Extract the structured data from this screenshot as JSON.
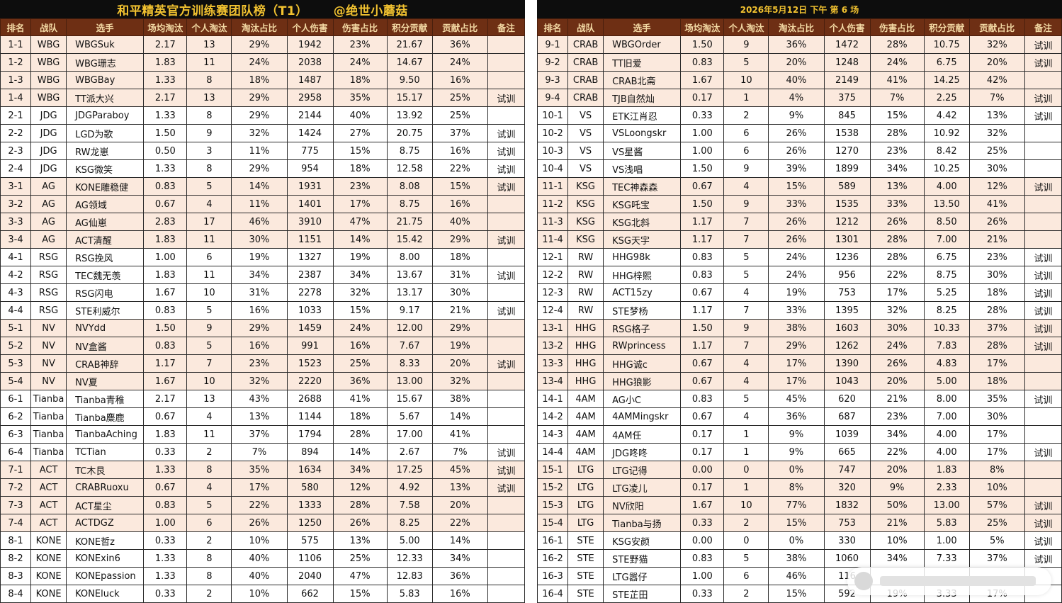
{
  "left": {
    "title": "和平精英官方训练赛团队榜（T1）",
    "author": "@绝世小蘑菇",
    "headers": [
      "排名",
      "战队",
      "选手",
      "场均淘汰",
      "个人淘汰",
      "淘汰占比",
      "个人伤害",
      "伤害占比",
      "积分贡献",
      "贡献占比",
      "备注"
    ],
    "rows": [
      [
        "1-1",
        "WBG",
        "WBGSuk",
        "2.17",
        "13",
        "29%",
        "1942",
        "23%",
        "21.67",
        "36%",
        ""
      ],
      [
        "1-2",
        "WBG",
        "WBG珊志",
        "1.83",
        "11",
        "24%",
        "2038",
        "24%",
        "14.67",
        "24%",
        ""
      ],
      [
        "1-3",
        "WBG",
        "WBGBay",
        "1.33",
        "8",
        "18%",
        "1487",
        "18%",
        "9.50",
        "16%",
        ""
      ],
      [
        "1-4",
        "WBG",
        "TT派大兴",
        "2.17",
        "13",
        "29%",
        "2958",
        "35%",
        "15.17",
        "25%",
        "试训"
      ],
      [
        "2-1",
        "JDG",
        "JDGParaboy",
        "1.33",
        "8",
        "29%",
        "2144",
        "40%",
        "13.92",
        "25%",
        ""
      ],
      [
        "2-2",
        "JDG",
        "LGD为歌",
        "1.50",
        "9",
        "32%",
        "1424",
        "27%",
        "20.75",
        "37%",
        "试训"
      ],
      [
        "2-3",
        "JDG",
        "RW龙崽",
        "0.50",
        "3",
        "11%",
        "775",
        "15%",
        "8.75",
        "16%",
        "试训"
      ],
      [
        "2-4",
        "JDG",
        "KSG微笑",
        "1.33",
        "8",
        "29%",
        "954",
        "18%",
        "12.58",
        "22%",
        "试训"
      ],
      [
        "3-1",
        "AG",
        "KONE雕稳健",
        "0.83",
        "5",
        "14%",
        "1931",
        "23%",
        "8.08",
        "15%",
        "试训"
      ],
      [
        "3-2",
        "AG",
        "AG领域",
        "0.67",
        "4",
        "11%",
        "1401",
        "17%",
        "8.75",
        "16%",
        ""
      ],
      [
        "3-3",
        "AG",
        "AG仙崽",
        "2.83",
        "17",
        "46%",
        "3910",
        "47%",
        "21.75",
        "40%",
        ""
      ],
      [
        "3-4",
        "AG",
        "ACT清醒",
        "1.83",
        "11",
        "30%",
        "1151",
        "14%",
        "15.42",
        "29%",
        "试训"
      ],
      [
        "4-1",
        "RSG",
        "RSG挽风",
        "1.00",
        "6",
        "19%",
        "1327",
        "19%",
        "8.00",
        "18%",
        ""
      ],
      [
        "4-2",
        "RSG",
        "TEC魏无羡",
        "1.83",
        "11",
        "34%",
        "2387",
        "34%",
        "13.67",
        "31%",
        "试训"
      ],
      [
        "4-3",
        "RSG",
        "RSG闪电",
        "1.67",
        "10",
        "31%",
        "2278",
        "32%",
        "13.17",
        "30%",
        ""
      ],
      [
        "4-4",
        "RSG",
        "STE利威尔",
        "0.83",
        "5",
        "16%",
        "1033",
        "15%",
        "9.17",
        "21%",
        "试训"
      ],
      [
        "5-1",
        "NV",
        "NVYdd",
        "1.50",
        "9",
        "29%",
        "1459",
        "24%",
        "12.00",
        "29%",
        ""
      ],
      [
        "5-2",
        "NV",
        "NV盒酱",
        "0.83",
        "5",
        "16%",
        "991",
        "16%",
        "7.67",
        "19%",
        ""
      ],
      [
        "5-3",
        "NV",
        "CRAB神辞",
        "1.17",
        "7",
        "23%",
        "1523",
        "25%",
        "8.33",
        "20%",
        "试训"
      ],
      [
        "5-4",
        "NV",
        "NV夏",
        "1.67",
        "10",
        "32%",
        "2220",
        "36%",
        "13.00",
        "32%",
        ""
      ],
      [
        "6-1",
        "Tianba",
        "Tianba青稚",
        "2.17",
        "13",
        "43%",
        "2688",
        "41%",
        "15.67",
        "38%",
        ""
      ],
      [
        "6-2",
        "Tianba",
        "Tianba麋鹿",
        "0.67",
        "4",
        "13%",
        "1144",
        "18%",
        "5.67",
        "14%",
        ""
      ],
      [
        "6-3",
        "Tianba",
        "TianbaAching",
        "1.83",
        "11",
        "37%",
        "1794",
        "28%",
        "17.00",
        "41%",
        ""
      ],
      [
        "6-4",
        "Tianba",
        "TCTian",
        "0.33",
        "2",
        "7%",
        "894",
        "14%",
        "2.67",
        "7%",
        "试训"
      ],
      [
        "7-1",
        "ACT",
        "TC木艮",
        "1.33",
        "8",
        "35%",
        "1634",
        "34%",
        "17.25",
        "45%",
        "试训"
      ],
      [
        "7-2",
        "ACT",
        "CRABRuoxu",
        "0.67",
        "4",
        "17%",
        "580",
        "12%",
        "4.92",
        "13%",
        "试训"
      ],
      [
        "7-3",
        "ACT",
        "ACT星尘",
        "0.83",
        "5",
        "22%",
        "1333",
        "28%",
        "7.58",
        "20%",
        ""
      ],
      [
        "7-4",
        "ACT",
        "ACTDGZ",
        "1.00",
        "6",
        "26%",
        "1250",
        "26%",
        "8.25",
        "22%",
        ""
      ],
      [
        "8-1",
        "KONE",
        "KONE哲z",
        "0.33",
        "2",
        "10%",
        "575",
        "13%",
        "5.00",
        "14%",
        ""
      ],
      [
        "8-2",
        "KONE",
        "KONExin6",
        "1.33",
        "8",
        "40%",
        "1106",
        "25%",
        "12.33",
        "34%",
        ""
      ],
      [
        "8-3",
        "KONE",
        "KONEpassion",
        "1.33",
        "8",
        "40%",
        "2040",
        "47%",
        "12.83",
        "36%",
        ""
      ],
      [
        "8-4",
        "KONE",
        "KONEluck",
        "0.33",
        "2",
        "10%",
        "662",
        "15%",
        "5.83",
        "16%",
        ""
      ]
    ]
  },
  "right": {
    "title": "2026年5月12日 下午 第 6 场",
    "headers": [
      "排名",
      "战队",
      "选手",
      "场均淘汰",
      "个人淘汰",
      "淘汰占比",
      "个人伤害",
      "伤害占比",
      "积分贡献",
      "贡献占比",
      "备注"
    ],
    "rows": [
      [
        "9-1",
        "CRAB",
        "WBGOrder",
        "1.50",
        "9",
        "36%",
        "1472",
        "28%",
        "10.75",
        "32%",
        "试训"
      ],
      [
        "9-2",
        "CRAB",
        "TT旧爱",
        "0.83",
        "5",
        "20%",
        "1248",
        "24%",
        "6.75",
        "20%",
        "试训"
      ],
      [
        "9-3",
        "CRAB",
        "CRAB北斋",
        "1.67",
        "10",
        "40%",
        "2149",
        "41%",
        "14.25",
        "42%",
        ""
      ],
      [
        "9-4",
        "CRAB",
        "TJB自然灿",
        "0.17",
        "1",
        "4%",
        "375",
        "7%",
        "2.25",
        "7%",
        "试训"
      ],
      [
        "10-1",
        "VS",
        "ETK江肖忍",
        "0.33",
        "2",
        "9%",
        "845",
        "15%",
        "4.42",
        "13%",
        "试训"
      ],
      [
        "10-2",
        "VS",
        "VSLoongskr",
        "1.00",
        "6",
        "26%",
        "1538",
        "28%",
        "10.92",
        "32%",
        ""
      ],
      [
        "10-3",
        "VS",
        "VS星酱",
        "1.00",
        "6",
        "26%",
        "1270",
        "23%",
        "8.42",
        "25%",
        ""
      ],
      [
        "10-4",
        "VS",
        "VS浅唱",
        "1.50",
        "9",
        "39%",
        "1899",
        "34%",
        "10.25",
        "30%",
        ""
      ],
      [
        "11-1",
        "KSG",
        "TEC神森森",
        "0.67",
        "4",
        "15%",
        "589",
        "13%",
        "4.00",
        "12%",
        "试训"
      ],
      [
        "11-2",
        "KSG",
        "KSG吒宝",
        "1.50",
        "9",
        "33%",
        "1535",
        "33%",
        "13.50",
        "41%",
        ""
      ],
      [
        "11-3",
        "KSG",
        "KSG北斜",
        "1.17",
        "7",
        "26%",
        "1212",
        "26%",
        "8.50",
        "26%",
        ""
      ],
      [
        "11-4",
        "KSG",
        "KSG天宇",
        "1.17",
        "7",
        "26%",
        "1301",
        "28%",
        "7.00",
        "21%",
        ""
      ],
      [
        "12-1",
        "RW",
        "HHG98k",
        "0.83",
        "5",
        "24%",
        "1236",
        "28%",
        "6.75",
        "23%",
        "试训"
      ],
      [
        "12-2",
        "RW",
        "HHG梓熙",
        "0.83",
        "5",
        "24%",
        "956",
        "22%",
        "8.75",
        "30%",
        "试训"
      ],
      [
        "12-3",
        "RW",
        "ACT15zy",
        "0.67",
        "4",
        "19%",
        "753",
        "17%",
        "5.25",
        "18%",
        "试训"
      ],
      [
        "12-4",
        "RW",
        "STE梦杨",
        "1.17",
        "7",
        "33%",
        "1395",
        "32%",
        "8.25",
        "28%",
        "试训"
      ],
      [
        "13-1",
        "HHG",
        "RSG格子",
        "1.50",
        "9",
        "38%",
        "1603",
        "30%",
        "10.33",
        "37%",
        "试训"
      ],
      [
        "13-2",
        "HHG",
        "RWprincess",
        "1.17",
        "7",
        "29%",
        "1262",
        "24%",
        "7.83",
        "28%",
        "试训"
      ],
      [
        "13-3",
        "HHG",
        "HHG诚c",
        "0.67",
        "4",
        "17%",
        "1390",
        "26%",
        "4.83",
        "17%",
        ""
      ],
      [
        "13-4",
        "HHG",
        "HHG狼影",
        "0.67",
        "4",
        "17%",
        "1043",
        "20%",
        "5.00",
        "18%",
        ""
      ],
      [
        "14-1",
        "4AM",
        "AG小C",
        "0.83",
        "5",
        "45%",
        "620",
        "21%",
        "8.00",
        "35%",
        "试训"
      ],
      [
        "14-2",
        "4AM",
        "4AMMingskr",
        "0.67",
        "4",
        "36%",
        "687",
        "23%",
        "7.00",
        "30%",
        ""
      ],
      [
        "14-3",
        "4AM",
        "4AM任",
        "0.17",
        "1",
        "9%",
        "1039",
        "34%",
        "4.00",
        "17%",
        ""
      ],
      [
        "14-4",
        "4AM",
        "JDG咚咚",
        "0.17",
        "1",
        "9%",
        "665",
        "22%",
        "4.00",
        "17%",
        "试训"
      ],
      [
        "15-1",
        "LTG",
        "LTG记得",
        "0.00",
        "0",
        "0%",
        "747",
        "20%",
        "1.83",
        "8%",
        ""
      ],
      [
        "15-2",
        "LTG",
        "LTG凌儿",
        "0.17",
        "1",
        "8%",
        "320",
        "9%",
        "2.33",
        "10%",
        ""
      ],
      [
        "15-3",
        "LTG",
        "NV欣阳",
        "1.67",
        "10",
        "77%",
        "1832",
        "50%",
        "13.00",
        "57%",
        "试训"
      ],
      [
        "15-4",
        "LTG",
        "Tianba与扬",
        "0.33",
        "2",
        "15%",
        "753",
        "21%",
        "5.83",
        "25%",
        "试训"
      ],
      [
        "16-1",
        "STE",
        "KSG安颜",
        "0.00",
        "0",
        "0%",
        "330",
        "10%",
        "1.00",
        "5%",
        "试训"
      ],
      [
        "16-2",
        "STE",
        "STE野猫",
        "0.83",
        "5",
        "38%",
        "1060",
        "34%",
        "7.33",
        "37%",
        "试训"
      ],
      [
        "16-3",
        "STE",
        "LTG嚣仔",
        "1.00",
        "6",
        "46%",
        "116",
        "",
        "",
        "",
        ""
      ],
      [
        "16-4",
        "STE",
        "STE芷田",
        "0.33",
        "2",
        "15%",
        "592",
        "19%",
        "3.33",
        "17%",
        ""
      ]
    ]
  }
}
